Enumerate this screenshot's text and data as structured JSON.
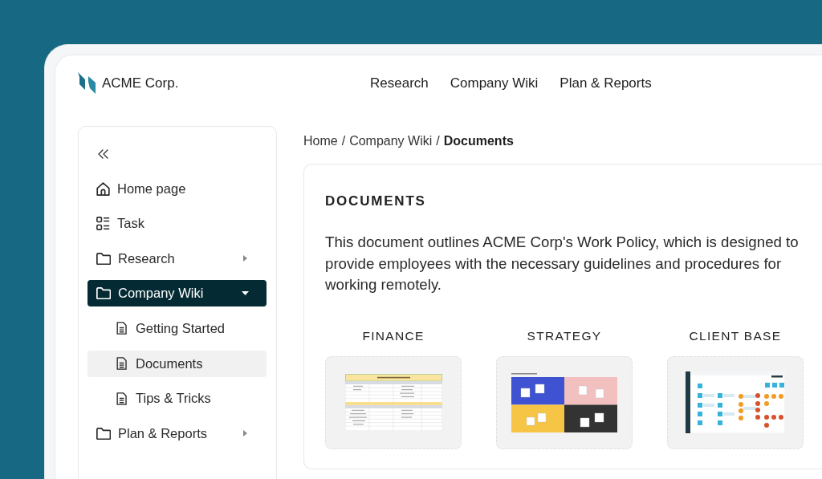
{
  "brand": {
    "name": "ACME Corp."
  },
  "nav": [
    {
      "label": "Research"
    },
    {
      "label": "Company Wiki"
    },
    {
      "label": "Plan & Reports"
    }
  ],
  "sidebar": {
    "items": [
      {
        "label": "Home page",
        "kind": "home",
        "selected": false
      },
      {
        "label": "Task",
        "kind": "tasks",
        "selected": false
      },
      {
        "label": "Research",
        "kind": "folder",
        "selected": false,
        "expanded": false
      },
      {
        "label": "Company Wiki",
        "kind": "folder",
        "selected": true,
        "expanded": true,
        "children": [
          {
            "label": "Getting Started",
            "kind": "document",
            "selected": false
          },
          {
            "label": "Documents",
            "kind": "document",
            "selected": true
          },
          {
            "label": "Tips & Tricks",
            "kind": "document",
            "selected": false
          }
        ]
      },
      {
        "label": "Plan & Reports",
        "kind": "folder",
        "selected": false,
        "expanded": false
      }
    ]
  },
  "breadcrumb": {
    "separator": "/",
    "items": [
      {
        "label": "Home",
        "current": false
      },
      {
        "label": "Company Wiki",
        "current": false
      },
      {
        "label": "Documents",
        "current": true
      }
    ]
  },
  "content": {
    "title": "DOCUMENTS",
    "description": "This document outlines ACME Corp's Work Policy, which is designed to provide employees with the necessary guidelines and procedures for working remotely.",
    "cards": [
      {
        "title": "FINANCE",
        "kind": "spreadsheet"
      },
      {
        "title": "STRATEGY",
        "kind": "board"
      },
      {
        "title": "CLIENT BASE",
        "kind": "flowchart"
      }
    ]
  }
}
